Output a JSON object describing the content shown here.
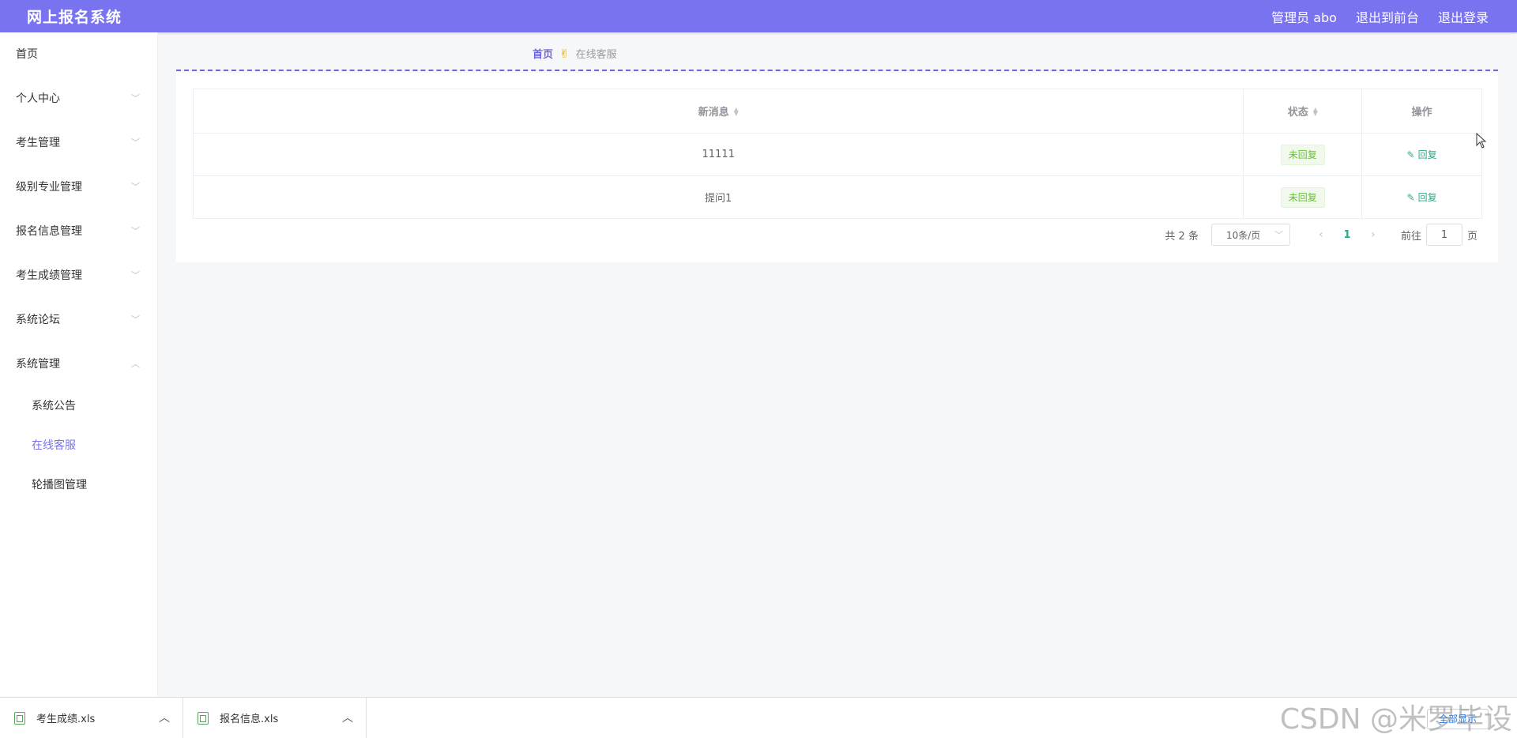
{
  "header": {
    "title": "网上报名系统",
    "user_label": "管理员 abo",
    "to_front": "退出到前台",
    "logout": "退出登录"
  },
  "sidebar": {
    "items": [
      {
        "label": "首页",
        "has_chevron": false
      },
      {
        "label": "个人中心",
        "has_chevron": true
      },
      {
        "label": "考生管理",
        "has_chevron": true
      },
      {
        "label": "级别专业管理",
        "has_chevron": true
      },
      {
        "label": "报名信息管理",
        "has_chevron": true
      },
      {
        "label": "考生成绩管理",
        "has_chevron": true
      },
      {
        "label": "系统论坛",
        "has_chevron": true
      },
      {
        "label": "系统管理",
        "has_chevron": true,
        "expanded": true
      }
    ],
    "subitems": [
      {
        "label": "系统公告"
      },
      {
        "label": "在线客服",
        "active": true
      },
      {
        "label": "轮播图管理"
      }
    ]
  },
  "breadcrumb": {
    "home": "首页",
    "separator_icon": "hand-icon",
    "current": "在线客服"
  },
  "table": {
    "headers": {
      "message": "新消息",
      "status": "状态",
      "action": "操作"
    },
    "rows": [
      {
        "message": "11111",
        "status": "未回复",
        "action": "回复"
      },
      {
        "message": "提问1",
        "status": "未回复",
        "action": "回复"
      }
    ]
  },
  "pagination": {
    "total": "共 2 条",
    "page_size": "10条/页",
    "current_page": "1",
    "goto_label": "前往",
    "goto_value": "1",
    "goto_suffix": "页"
  },
  "downloads": {
    "items": [
      {
        "name": "考生成绩.xls"
      },
      {
        "name": "报名信息.xls"
      }
    ],
    "show_all": "全部显示"
  },
  "watermark": "CSDN @米罗毕设",
  "colors": {
    "primary": "#7a73f0",
    "tag_green": "#67c23a",
    "link_teal": "#2fa98a"
  }
}
